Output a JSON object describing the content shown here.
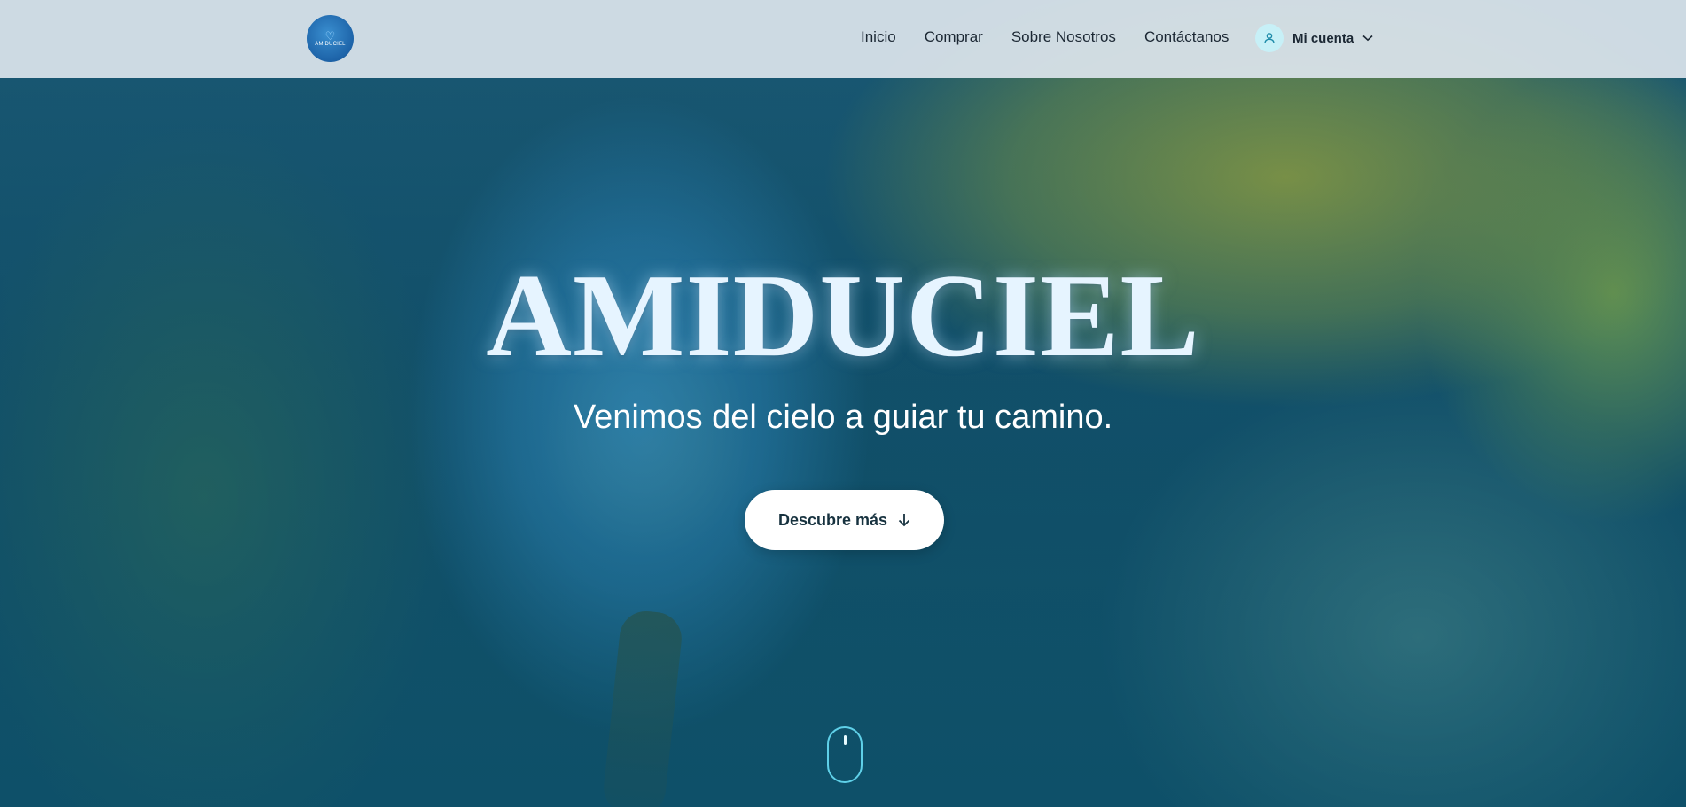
{
  "brand": {
    "logo_text": "AMIDUCIEL"
  },
  "nav": {
    "items": [
      {
        "label": "Inicio"
      },
      {
        "label": "Comprar"
      },
      {
        "label": "Sobre Nosotros"
      },
      {
        "label": "Contáctanos"
      }
    ],
    "account_label": "Mi cuenta"
  },
  "hero": {
    "title": "AMIDUCIEL",
    "subtitle": "Venimos del cielo a guiar tu camino.",
    "cta_label": "Descubre más"
  },
  "icons": {
    "account": "user-icon",
    "dropdown": "chevron-down-icon",
    "cta": "arrow-down-icon",
    "scroll": "mouse-scroll-icon"
  },
  "colors": {
    "nav_background": "#dce4ec",
    "accent": "#5fd0e8",
    "title": "#e6f4ff",
    "button_bg": "#ffffff",
    "button_text": "#17323f"
  }
}
